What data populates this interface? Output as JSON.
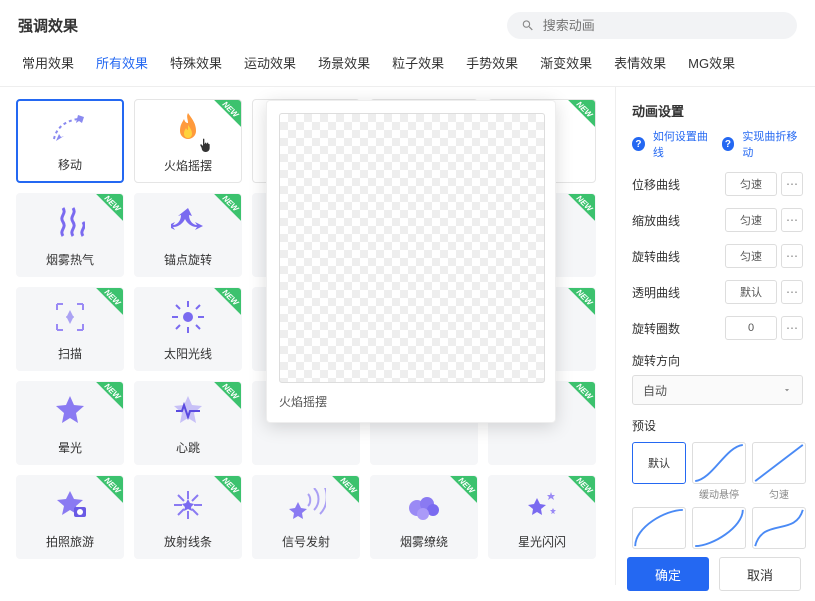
{
  "header": {
    "title": "强调效果",
    "searchPlaceholder": "搜索动画"
  },
  "tabs": [
    "常用效果",
    "所有效果",
    "特殊效果",
    "运动效果",
    "场景效果",
    "粒子效果",
    "手势效果",
    "渐变效果",
    "表情效果",
    "MG效果"
  ],
  "activeTab": 1,
  "effects": [
    {
      "label": "移动",
      "new": false,
      "selected": true
    },
    {
      "label": "火焰摇摆",
      "new": true,
      "cursor": true
    },
    {
      "label": "",
      "new": true
    },
    {
      "label": "",
      "new": true
    },
    {
      "label": "",
      "new": true
    },
    {
      "label": "烟雾热气",
      "new": true,
      "gray": true
    },
    {
      "label": "锚点旋转",
      "new": true,
      "gray": true
    },
    {
      "label": "",
      "new": true,
      "gray": true
    },
    {
      "label": "",
      "new": true,
      "gray": true
    },
    {
      "label": "",
      "new": true,
      "gray": true
    },
    {
      "label": "扫描",
      "new": true,
      "gray": true
    },
    {
      "label": "太阳光线",
      "new": true,
      "gray": true
    },
    {
      "label": "",
      "new": true,
      "gray": true
    },
    {
      "label": "",
      "new": true,
      "gray": true
    },
    {
      "label": "",
      "new": true,
      "gray": true
    },
    {
      "label": "晕光",
      "new": true,
      "gray": true
    },
    {
      "label": "心跳",
      "new": true,
      "gray": true
    },
    {
      "label": "",
      "new": true,
      "gray": true
    },
    {
      "label": "",
      "new": true,
      "gray": true
    },
    {
      "label": "",
      "new": true,
      "gray": true
    },
    {
      "label": "拍照旅游",
      "new": true,
      "gray": true
    },
    {
      "label": "放射线条",
      "new": true,
      "gray": true
    },
    {
      "label": "信号发射",
      "new": true,
      "gray": true
    },
    {
      "label": "烟雾缭绕",
      "new": true,
      "gray": true
    },
    {
      "label": "星光闪闪",
      "new": true,
      "gray": true
    }
  ],
  "newBadge": "NEW",
  "preview": {
    "label": "火焰摇摆"
  },
  "settings": {
    "title": "动画设置",
    "help1": "如何设置曲线",
    "help2": "实现曲折移动",
    "rows": [
      {
        "label": "位移曲线",
        "value": "匀速"
      },
      {
        "label": "缩放曲线",
        "value": "匀速"
      },
      {
        "label": "旋转曲线",
        "value": "匀速"
      },
      {
        "label": "透明曲线",
        "value": "默认"
      }
    ],
    "rotationCountLabel": "旋转圈数",
    "rotationCount": "0",
    "rotationDirLabel": "旋转方向",
    "rotationDir": "自动",
    "presetsLabel": "预设",
    "presets": [
      {
        "label": "默认",
        "text": true
      },
      {
        "label": "缓动悬停"
      },
      {
        "label": "匀速"
      },
      {
        "label": ""
      },
      {
        "label": ""
      },
      {
        "label": ""
      }
    ]
  },
  "footer": {
    "ok": "确定",
    "cancel": "取消"
  }
}
